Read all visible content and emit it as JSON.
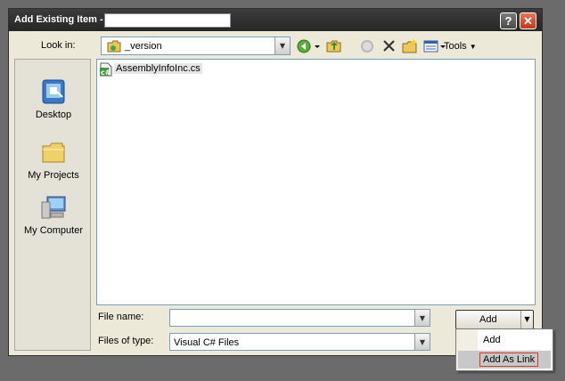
{
  "dialog": {
    "title": "Add Existing Item -",
    "title_field_value": "",
    "help_button": "?",
    "close_button": "✕"
  },
  "lookin": {
    "label": "Look in:",
    "value": "_version"
  },
  "toolbar": {
    "tools_label": "Tools",
    "icons": [
      "back-icon",
      "up-folder-icon",
      "search-web-icon",
      "delete-icon",
      "new-folder-icon",
      "views-icon"
    ]
  },
  "places": [
    {
      "label": "Desktop",
      "icon": "desktop-icon"
    },
    {
      "label": "My Projects",
      "icon": "folder-icon"
    },
    {
      "label": "My Computer",
      "icon": "computer-icon"
    }
  ],
  "files": [
    {
      "name": "AssemblyInfoInc.cs",
      "icon": "csharp-file-icon"
    }
  ],
  "filename": {
    "label": "File name:",
    "value": ""
  },
  "filetype": {
    "label": "Files of type:",
    "value": "Visual C# Files"
  },
  "add_button": {
    "label": "Add"
  },
  "add_menu": {
    "items": [
      "Add",
      "Add As Link"
    ],
    "highlighted_item": "Add As Link"
  },
  "colors": {
    "titlebar": "#2f2f2f",
    "dialog_face": "#ece9d8",
    "highlight_border": "#d23a2a",
    "desktop": "#6b6b6b"
  }
}
